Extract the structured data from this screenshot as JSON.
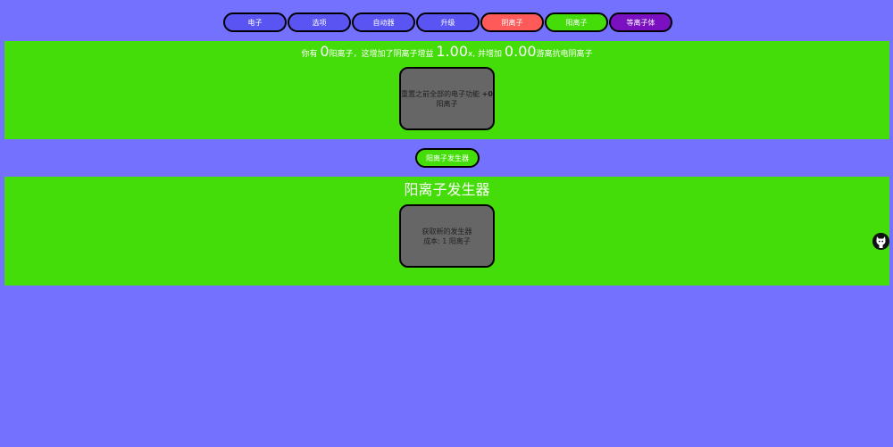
{
  "tabs": [
    {
      "label": "电子",
      "kind": "default"
    },
    {
      "label": "选项",
      "kind": "default"
    },
    {
      "label": "自动器",
      "kind": "default"
    },
    {
      "label": "升级",
      "kind": "default"
    },
    {
      "label": "阴离子",
      "kind": "neg"
    },
    {
      "label": "阳离子",
      "kind": "pos"
    },
    {
      "label": "等离子体",
      "kind": "plasma"
    }
  ],
  "stats": {
    "prefix": "你有 ",
    "cations_value": "0",
    "text1": "阳离子，这增加了阴离子增益 ",
    "multiplier_value": "1.00",
    "text2": "x, 并增加 ",
    "resist_value": "0.00",
    "text3": "游离抗电阴离子"
  },
  "reset_card": {
    "line1": "重置之前全部的电子功能",
    "plus": "+0",
    "line2": "阳离子"
  },
  "subtab": {
    "label": "阳离子发生器"
  },
  "generator_section": {
    "title": "阳离子发生器",
    "card_line1": "获取新的发生器",
    "card_line2": "成本: 1 阳离子"
  },
  "colors": {
    "background": "#7571ff",
    "panel": "#44dd0a",
    "tab": "#5a55f2",
    "tab_negative": "#ff5a5a",
    "tab_positive": "#44dd0a",
    "tab_plasma": "#7a10c0",
    "card": "#666666"
  },
  "icons": {
    "corner": "github-icon"
  }
}
